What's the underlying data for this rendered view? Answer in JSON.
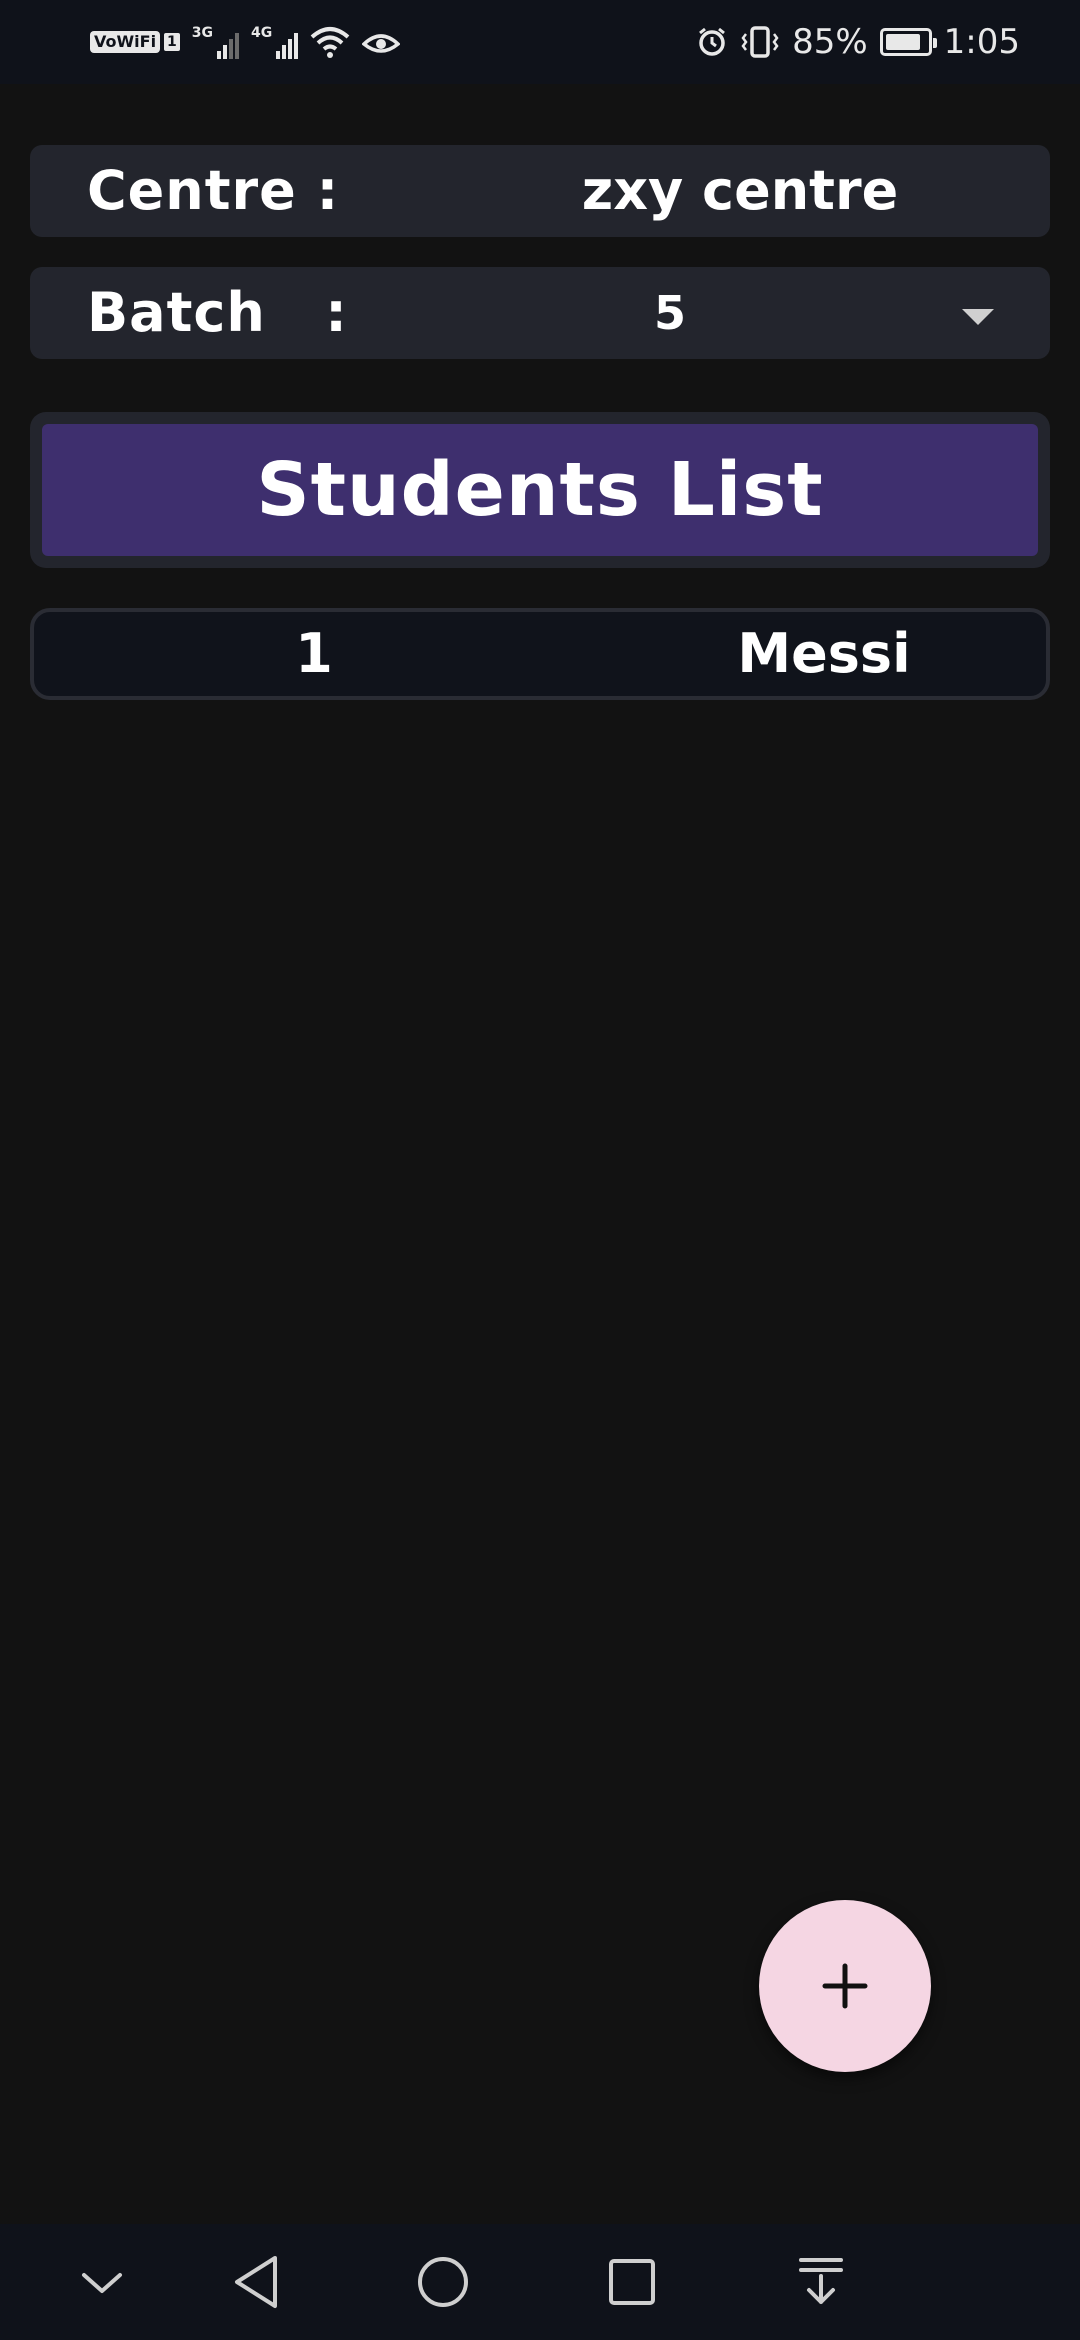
{
  "status_bar": {
    "vowifi": "VoWiFi",
    "sim_slot": "1",
    "net1": "3G",
    "net2": "4G",
    "battery_percent": "85%",
    "battery_level": 0.85,
    "time": "1:05"
  },
  "form": {
    "centre_label": "Centre :",
    "centre_value": "zxy centre",
    "batch_label": "Batch   :",
    "batch_value": "5"
  },
  "list": {
    "header": "Students List",
    "rows": [
      {
        "number": "1",
        "name": "Messi"
      }
    ]
  },
  "fab": {
    "icon": "plus-icon"
  },
  "nav": {
    "items": [
      "chevron-down-icon",
      "back-icon",
      "home-icon",
      "recents-icon",
      "notification-shade-icon"
    ]
  }
}
